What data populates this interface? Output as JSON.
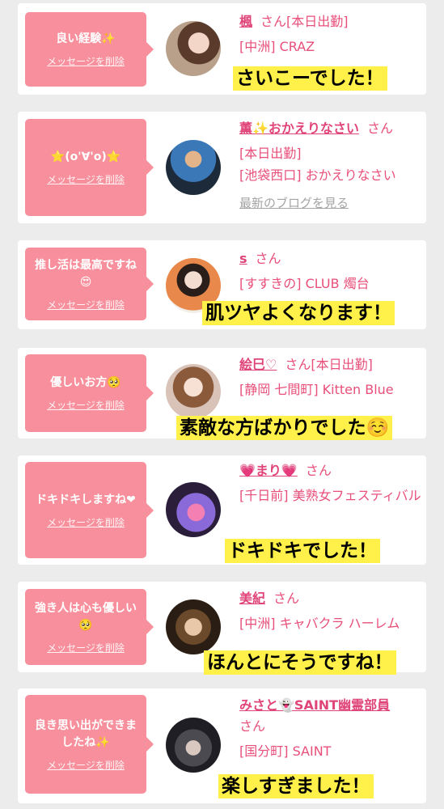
{
  "delete_label": "メッセージを削除",
  "san_label": "さん",
  "blog_label": "最新のブログを見る",
  "cards": [
    {
      "message": "良い経験✨",
      "name": "楓",
      "lines": [
        "[中洲] CRAZ"
      ],
      "caption": "さいこーでした！"
    },
    {
      "message": "⭐(o'∀'o)⭐",
      "name": "薫✨おかえりなさい",
      "lines": [
        "[本日出勤]",
        "[池袋西口] おかえりなさい"
      ],
      "caption": ""
    },
    {
      "message": "推し活は最高ですね😍",
      "name": "s",
      "lines": [
        "[すすきの] CLUB 燭台"
      ],
      "caption": "肌ツヤよくなります！"
    },
    {
      "message": "優しいお方🥺",
      "name": "絵巳♡",
      "lines": [
        "[静岡 七間町] Kitten Blue"
      ],
      "caption": "素敵な方ばかりでした☺️"
    },
    {
      "message": "ドキドキしますね❤",
      "name": "💗まり💗",
      "lines": [
        "[千日前] 美熟女フェスティバル"
      ],
      "caption": "ドキドキでした！"
    },
    {
      "message": "強き人は心も優しい🥺",
      "name": "美紀",
      "lines": [
        "[中洲] キャバクラ ハーレム"
      ],
      "caption": "ほんとにそうですね！"
    },
    {
      "message": "良き思い出ができましたね✨",
      "name": "みさと👻SAINT幽霊部員",
      "lines": [
        "[国分町] SAINT"
      ],
      "caption": "楽しすぎました！"
    }
  ],
  "extra": {
    "first_status": "[本日出勤]",
    "fourth_status": "[本日出勤]"
  }
}
